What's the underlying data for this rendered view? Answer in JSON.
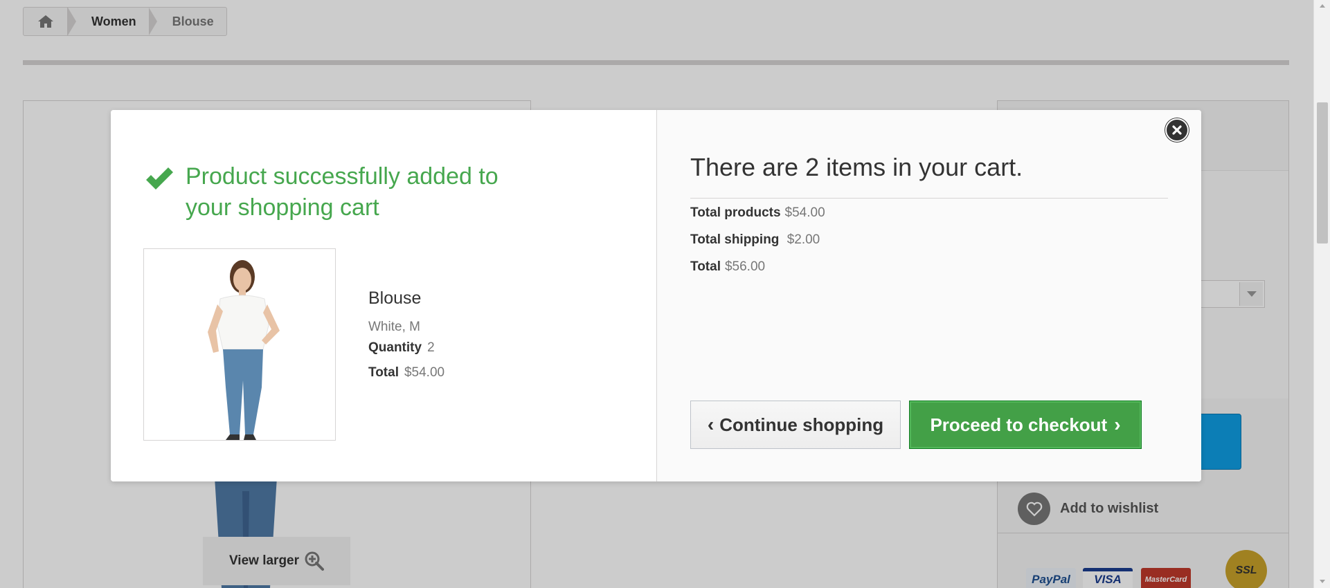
{
  "breadcrumb": {
    "home_icon": "home-icon",
    "items": [
      "Women",
      "Blouse"
    ]
  },
  "background": {
    "view_larger": "View larger",
    "add_to_wishlist": "Add to wishlist",
    "payment_logos": [
      "PayPal",
      "VISA",
      "MasterCard",
      "SSL"
    ]
  },
  "modal": {
    "success_title": "Product successfully added to your shopping cart",
    "product": {
      "name": "Blouse",
      "attributes": "White, M",
      "quantity_label": "Quantity",
      "quantity": "2",
      "total_label": "Total",
      "total": "$54.00"
    },
    "cart": {
      "heading": "There are 2 items in your cart.",
      "total_products_label": "Total products",
      "total_products": "$54.00",
      "total_shipping_label": "Total shipping",
      "total_shipping": "$2.00",
      "total_label": "Total",
      "total": "$56.00"
    },
    "buttons": {
      "continue": "Continue shopping",
      "checkout": "Proceed to checkout"
    }
  },
  "colors": {
    "success_green": "#46a74e",
    "checkout_green": "#43a047",
    "accent_blue": "#0f9ee4"
  }
}
